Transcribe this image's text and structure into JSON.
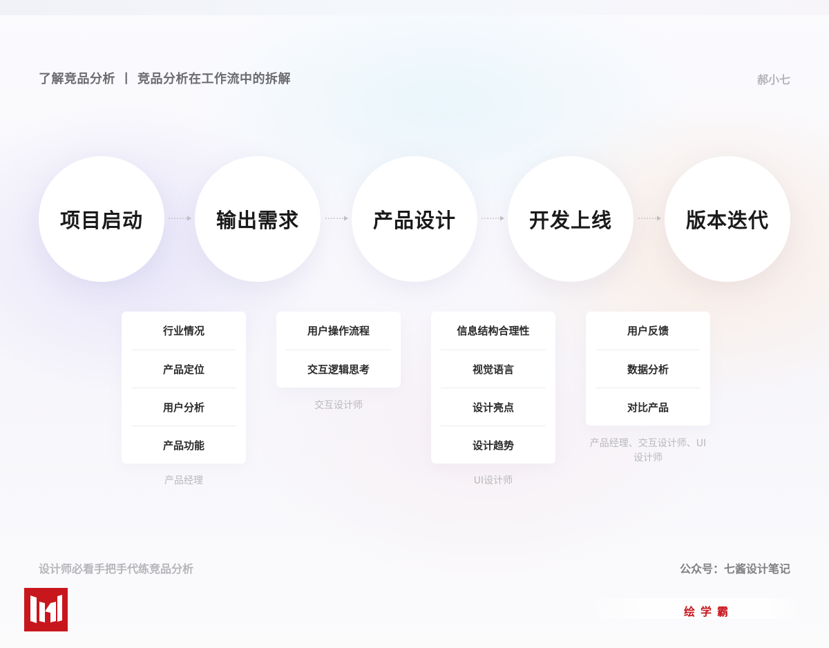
{
  "header": {
    "title": "了解竞品分析 丨 竞品分析在工作流中的拆解",
    "author": "郝小七"
  },
  "stages": [
    {
      "label": "项目启动"
    },
    {
      "label": "输出需求"
    },
    {
      "label": "产品设计"
    },
    {
      "label": "开发上线"
    },
    {
      "label": "版本迭代"
    }
  ],
  "cards": [
    {
      "items": [
        "行业情况",
        "产品定位",
        "用户分析",
        "产品功能"
      ],
      "role": "产品经理"
    },
    {
      "items": [
        "用户操作流程",
        "交互逻辑思考"
      ],
      "role": "交互设计师"
    },
    {
      "items": [
        "信息结构合理性",
        "视觉语言",
        "设计亮点",
        "设计趋势"
      ],
      "role": "UI设计师"
    },
    {
      "items": [
        "用户反馈",
        "数据分析",
        "对比产品"
      ],
      "role": "产品经理、交互设计师、UI设计师"
    }
  ],
  "footer": {
    "left": "设计师必看手把手代练竞品分析",
    "right": "公众号：七酱设计笔记",
    "brand": "绘学霸"
  },
  "colors": {
    "brand_red": "#c8161d",
    "arrow_gray": "#bdbdc2"
  },
  "icons": {
    "logo": "iw-logo-icon",
    "connector": "dotted-arrow-icon"
  }
}
